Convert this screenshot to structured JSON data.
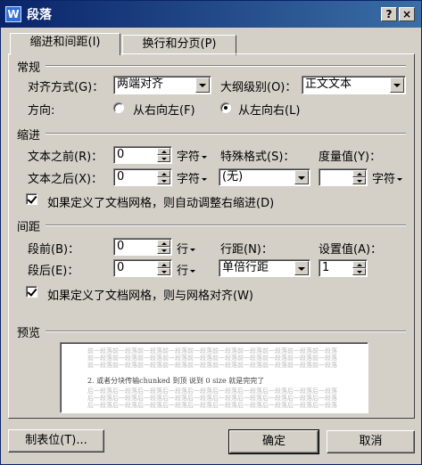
{
  "window": {
    "title": "段落",
    "app_icon_letter": "W"
  },
  "titlebar_buttons": {
    "help": "?",
    "close": "×"
  },
  "tabs": [
    "缩进和间距(I)",
    "换行和分页(P)"
  ],
  "general": {
    "section": "常规",
    "alignment_label": "对齐方式(G)：",
    "alignment_value": "两端对齐",
    "outline_label": "大纲级别(O)：",
    "outline_value": "正文文本",
    "direction_label": "方向:",
    "rtl_label": "从右向左(F)",
    "ltr_label": "从左向右(L)"
  },
  "indent": {
    "section": "缩进",
    "before_label": "文本之前(R)：",
    "before_value": "0",
    "before_unit": "字符",
    "after_label": "文本之后(X)：",
    "after_value": "0",
    "after_unit": "字符",
    "special_label": "特殊格式(S)：",
    "special_value": "(无)",
    "measure_label": "度量值(Y)：",
    "measure_value": "",
    "measure_unit": "字符",
    "grid_check_label": "如果定义了文档网格，则自动调整右缩进(D)"
  },
  "spacing": {
    "section": "间距",
    "before_label": "段前(B)：",
    "before_value": "0",
    "before_unit": "行",
    "after_label": "段后(E)：",
    "after_value": "0",
    "after_unit": "行",
    "line_label": "行距(N)：",
    "line_value": "单倍行距",
    "setting_label": "设置值(A)：",
    "setting_value": "1",
    "grid_check_label": "如果定义了文档网格，则与网格对齐(W)"
  },
  "preview": {
    "section": "预览",
    "prev_line": "前一段落前一段落前一段落前一段落前一段落前一段落前一段落前一段落前一段落前一段落",
    "current_line": "2. 或者分块传输chunked 到顶  说到 0 size 就是完完了",
    "next_line": "后一段落后一段落后一段落后一段落后一段落后一段落后一段落后一段落后一段落后一段落"
  },
  "buttons": {
    "tabs": "制表位(T)...",
    "ok": "确定",
    "cancel": "取消"
  }
}
